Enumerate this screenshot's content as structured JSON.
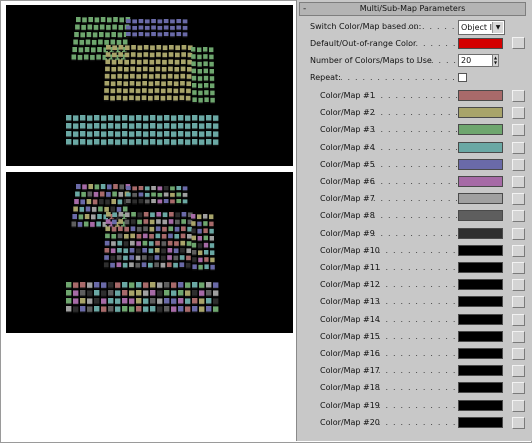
{
  "panel": {
    "title": "Multi/Sub-Map Parameters",
    "toggle": "-",
    "switch_label": "Switch Color/Map based on:",
    "switch_value": "Object ID",
    "default_label": "Default/Out-of-range Color",
    "default_color": "#d40000",
    "num_label": "Number of Colors/Maps to Use",
    "num_value": "20",
    "repeat_label": "Repeat:",
    "repeat_checked": false
  },
  "maps": [
    {
      "label": "Color/Map #1",
      "color": "#a86a6a"
    },
    {
      "label": "Color/Map #2",
      "color": "#a8a46a"
    },
    {
      "label": "Color/Map #3",
      "color": "#6ea66e"
    },
    {
      "label": "Color/Map #4",
      "color": "#6aa8a4"
    },
    {
      "label": "Color/Map #5",
      "color": "#6a6aa8"
    },
    {
      "label": "Color/Map #6",
      "color": "#a66aa6"
    },
    {
      "label": "Color/Map #7",
      "color": "#a0a0a0"
    },
    {
      "label": "Color/Map #8",
      "color": "#5e5e5e"
    },
    {
      "label": "Color/Map #9",
      "color": "#2e2e2e"
    },
    {
      "label": "Color/Map #10",
      "color": "#000000"
    },
    {
      "label": "Color/Map #11",
      "color": "#000000"
    },
    {
      "label": "Color/Map #12",
      "color": "#000000"
    },
    {
      "label": "Color/Map #13",
      "color": "#000000"
    },
    {
      "label": "Color/Map #14",
      "color": "#000000"
    },
    {
      "label": "Color/Map #15",
      "color": "#000000"
    },
    {
      "label": "Color/Map #16",
      "color": "#000000"
    },
    {
      "label": "Color/Map #17",
      "color": "#000000"
    },
    {
      "label": "Color/Map #18",
      "color": "#000000"
    },
    {
      "label": "Color/Map #19",
      "color": "#000000"
    },
    {
      "label": "Color/Map #20",
      "color": "#000000"
    }
  ]
}
